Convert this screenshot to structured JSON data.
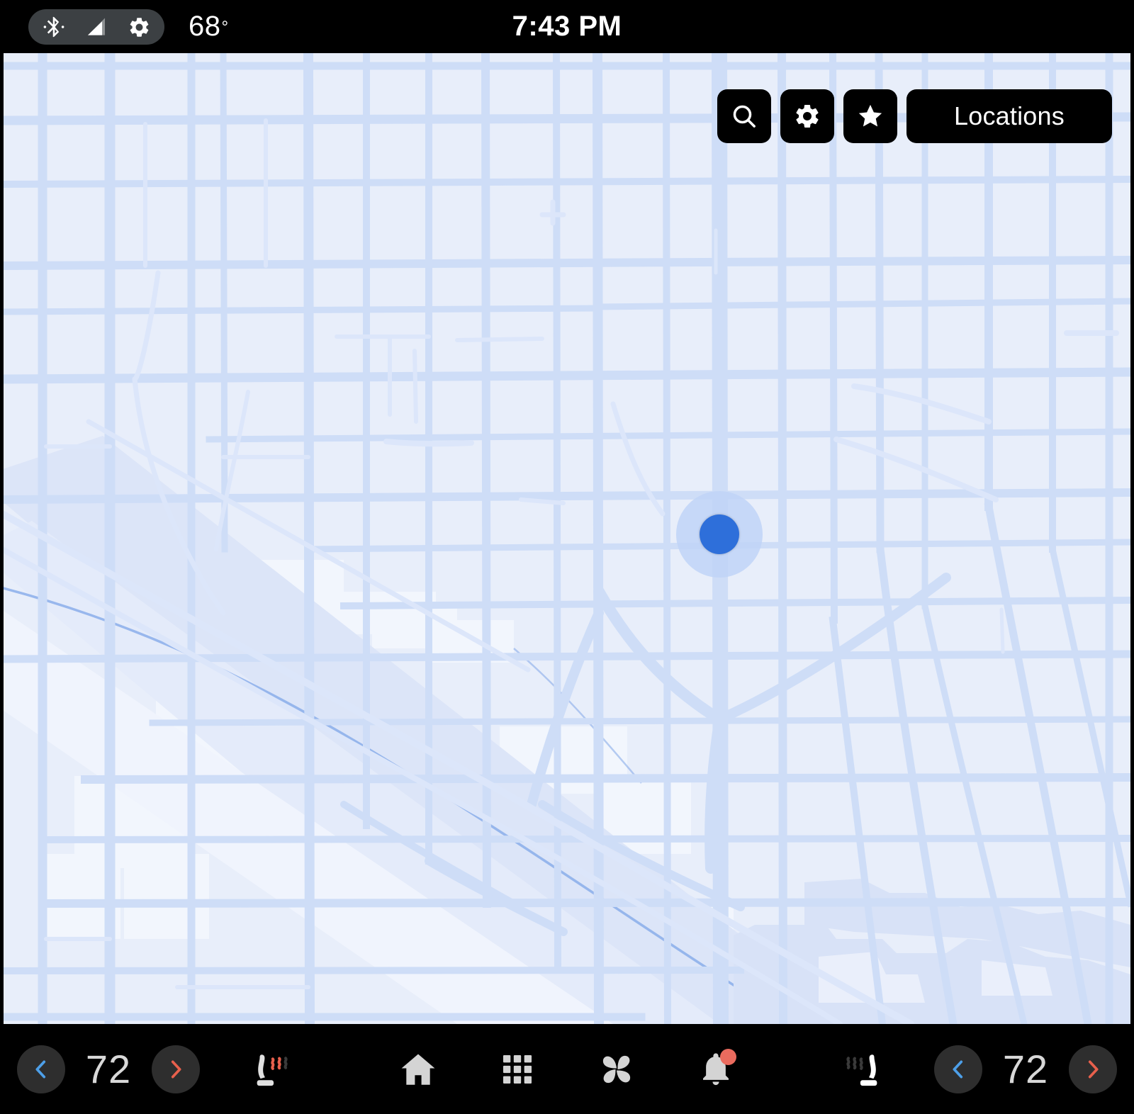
{
  "status_bar": {
    "icons": [
      "bluetooth-icon",
      "cellular-signal-icon",
      "gear-icon"
    ],
    "outside_temp": "68",
    "degree_symbol": "°",
    "clock": "7:43 PM"
  },
  "map": {
    "background_color": "#E8EEFA",
    "street_color": "#CEDDF7",
    "street_color_light": "#DCE6FA",
    "water_color": "#DCE5F8",
    "block_fill_light": "#F2F6FD",
    "river_line_color": "#7FA6E8",
    "marker": {
      "dot_color": "#2E6FDA",
      "halo_color": "#BFD4F7",
      "label": "current-location"
    },
    "controls": [
      {
        "name": "search-button",
        "icon": "search-icon",
        "label": ""
      },
      {
        "name": "map-settings-button",
        "icon": "gear-icon",
        "label": ""
      },
      {
        "name": "favorites-button",
        "icon": "star-icon",
        "label": ""
      },
      {
        "name": "locations-button",
        "icon": "",
        "label": "Locations"
      }
    ]
  },
  "bottom_bar": {
    "driver_climate": {
      "decrease_label": "‹",
      "temperature": "72",
      "increase_label": "›",
      "seat_icon": "heated-seat-icon",
      "seat_active": true
    },
    "passenger_climate": {
      "decrease_label": "‹",
      "temperature": "72",
      "increase_label": "›",
      "seat_icon": "heated-seat-icon",
      "seat_active": false
    },
    "nav_items": [
      {
        "name": "home-button",
        "icon": "home-icon"
      },
      {
        "name": "apps-button",
        "icon": "grid-apps-icon"
      },
      {
        "name": "climate-button",
        "icon": "fan-icon"
      },
      {
        "name": "notifications-button",
        "icon": "bell-icon",
        "badge": true
      }
    ],
    "colors": {
      "decrease_arrow": "#4D9FE8",
      "increase_arrow": "#E8604C",
      "circle_bg": "#2E2E2E",
      "temp_text": "#D8D8D8",
      "icon": "#D4D4D4",
      "badge": "#EA6B5E",
      "seat_heat_active": "#E8604C",
      "seat_heat_inactive": "#3A3A3A"
    }
  }
}
